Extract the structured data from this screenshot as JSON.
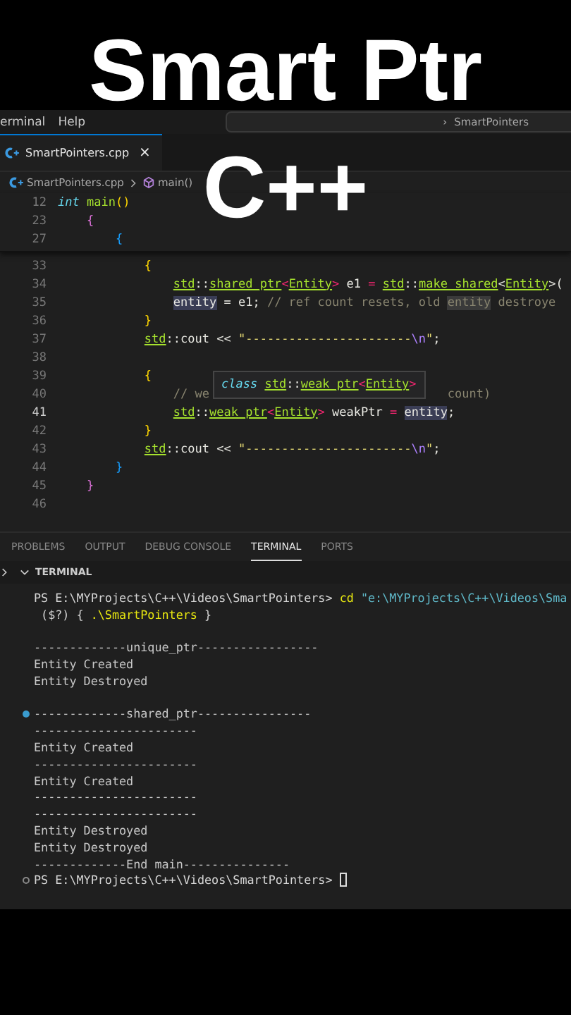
{
  "overlay_title": [
    "Smart Ptr",
    "C++"
  ],
  "menu": [
    "erminal",
    "Help"
  ],
  "command_center": {
    "separator": "›",
    "label": "SmartPointers"
  },
  "tabs": [
    {
      "label": "SmartPointers.cpp",
      "selected": true,
      "close": "×"
    }
  ],
  "breadcrumbs": [
    {
      "label": "SmartPointers.cpp",
      "kind": "file"
    },
    {
      "label": "main()",
      "kind": "symbol"
    }
  ],
  "sticky_lines": [
    {
      "n": "12",
      "tokens": [
        {
          "t": "int",
          "kind": "kw"
        },
        {
          "t": " main",
          "kind": "fn"
        },
        {
          "t": "()",
          "kind": "bg"
        }
      ]
    },
    {
      "n": "23",
      "tokens": [
        {
          "t": "    {",
          "kind": "bm"
        }
      ]
    },
    {
      "n": "27",
      "tokens": [
        {
          "t": "        {",
          "kind": "bb"
        }
      ]
    }
  ],
  "code_lines": [
    {
      "n": "33",
      "tokens": [
        {
          "t": "            {",
          "kind": "bg"
        }
      ]
    },
    {
      "n": "34",
      "tokens": [
        {
          "t": "                std",
          "kind": "ns"
        },
        {
          "t": "::",
          "kind": "plain"
        },
        {
          "t": "shared_ptr",
          "kind": "ns"
        },
        {
          "t": "<",
          "kind": "op"
        },
        {
          "t": "Entity",
          "kind": "ns"
        },
        {
          "t": ">",
          "kind": "op"
        },
        {
          "t": " e1 ",
          "kind": "plain"
        },
        {
          "t": "= ",
          "kind": "op"
        },
        {
          "t": "std",
          "kind": "ns"
        },
        {
          "t": "::",
          "kind": "plain"
        },
        {
          "t": "make_shared",
          "kind": "ns"
        },
        {
          "t": "<",
          "kind": "plain"
        },
        {
          "t": "Entity",
          "kind": "ns"
        },
        {
          "t": ">(",
          "kind": "plain"
        }
      ]
    },
    {
      "n": "35",
      "tokens": [
        {
          "t": "                entity",
          "kind": "hl"
        },
        {
          "t": " = e1; ",
          "kind": "plain"
        },
        {
          "t": "// ref count resets, old ",
          "kind": "com"
        },
        {
          "t": "entity",
          "kind": "comhl"
        },
        {
          "t": " destroye",
          "kind": "com"
        }
      ]
    },
    {
      "n": "36",
      "tokens": [
        {
          "t": "            }",
          "kind": "bg"
        }
      ]
    },
    {
      "n": "37",
      "tokens": [
        {
          "t": "            std",
          "kind": "ns"
        },
        {
          "t": "::cout << ",
          "kind": "plain"
        },
        {
          "t": "\"-----------------------",
          "kind": "str"
        },
        {
          "t": "\\n",
          "kind": "esc"
        },
        {
          "t": "\"",
          "kind": "str"
        },
        {
          "t": ";",
          "kind": "plain"
        }
      ]
    },
    {
      "n": "38"
    },
    {
      "n": "39",
      "tokens": [
        {
          "t": "            {",
          "kind": "bg"
        }
      ]
    },
    {
      "n": "40",
      "segments": [
        [
          {
            "t": "                // we",
            "kind": "com"
          }
        ],
        [
          {
            "t": "                                 count)",
            "kind": "com"
          }
        ]
      ]
    },
    {
      "n": "41",
      "tokens": [
        {
          "t": "                std",
          "kind": "ns"
        },
        {
          "t": "::",
          "kind": "plain"
        },
        {
          "t": "weak_ptr",
          "kind": "ns"
        },
        {
          "t": "<",
          "kind": "op"
        },
        {
          "t": "Entity",
          "kind": "ns"
        },
        {
          "t": ">",
          "kind": "op"
        },
        {
          "t": " weakPtr ",
          "kind": "plain"
        },
        {
          "t": "= ",
          "kind": "op"
        },
        {
          "t": "entity",
          "kind": "hl"
        },
        {
          "t": ";",
          "kind": "plain"
        }
      ]
    },
    {
      "n": "42",
      "tokens": [
        {
          "t": "            }",
          "kind": "bg"
        }
      ]
    },
    {
      "n": "43",
      "tokens": [
        {
          "t": "            std",
          "kind": "ns"
        },
        {
          "t": "::cout << ",
          "kind": "plain"
        },
        {
          "t": "\"-----------------------",
          "kind": "str"
        },
        {
          "t": "\\n",
          "kind": "esc"
        },
        {
          "t": "\"",
          "kind": "str"
        },
        {
          "t": ";",
          "kind": "plain"
        }
      ]
    },
    {
      "n": "44",
      "tokens": [
        {
          "t": "        }",
          "kind": "bb"
        }
      ]
    },
    {
      "n": "45",
      "tokens": [
        {
          "t": "    }",
          "kind": "bm"
        }
      ]
    },
    {
      "n": "46"
    }
  ],
  "hover": {
    "tokens": [
      {
        "t": "class",
        "kind": "kw"
      },
      {
        "t": " std",
        "kind": "ns"
      },
      {
        "t": "::",
        "kind": "plain"
      },
      {
        "t": "weak_ptr",
        "kind": "ns"
      },
      {
        "t": "<",
        "kind": "op"
      },
      {
        "t": "Entity",
        "kind": "ns"
      },
      {
        "t": ">",
        "kind": "op"
      }
    ]
  },
  "panel_tabs": [
    {
      "label": "PROBLEMS",
      "selected": false
    },
    {
      "label": "OUTPUT",
      "selected": false
    },
    {
      "label": "DEBUG CONSOLE",
      "selected": false
    },
    {
      "label": "TERMINAL",
      "selected": true
    },
    {
      "label": "PORTS",
      "selected": false
    }
  ],
  "terminal": {
    "title": "TERMINAL",
    "lines": [
      {
        "kind": "text",
        "segs": [
          {
            "t": "PS E:\\MYProjects\\C++\\Videos\\SmartPointers> ",
            "kind": "plain"
          },
          {
            "t": "cd",
            "kind": "cmd"
          },
          {
            "t": " \"e:\\MYProjects\\C++\\Videos\\Sma",
            "kind": "arg"
          }
        ]
      },
      {
        "kind": "text",
        "segs": [
          {
            "t": " ($?) { ",
            "kind": "plain"
          },
          {
            "t": ".\\SmartPointers",
            "kind": "cmd"
          },
          {
            "t": " }",
            "kind": "plain"
          }
        ]
      },
      {
        "kind": "blank"
      },
      {
        "kind": "text",
        "segs": [
          {
            "t": "-------------unique_ptr-----------------",
            "kind": "out"
          }
        ]
      },
      {
        "kind": "text",
        "segs": [
          {
            "t": "Entity Created",
            "kind": "out"
          }
        ]
      },
      {
        "kind": "text",
        "segs": [
          {
            "t": "Entity Destroyed",
            "kind": "out"
          }
        ]
      },
      {
        "kind": "blank"
      },
      {
        "kind": "text",
        "marker": true,
        "done": true,
        "segs": [
          {
            "t": "-------------shared_ptr----------------",
            "kind": "out"
          }
        ]
      },
      {
        "kind": "text",
        "segs": [
          {
            "t": "-----------------------",
            "kind": "out"
          }
        ]
      },
      {
        "kind": "text",
        "segs": [
          {
            "t": "Entity Created",
            "kind": "out"
          }
        ]
      },
      {
        "kind": "text",
        "segs": [
          {
            "t": "-----------------------",
            "kind": "out"
          }
        ]
      },
      {
        "kind": "text",
        "segs": [
          {
            "t": "Entity Created",
            "kind": "out"
          }
        ]
      },
      {
        "kind": "text",
        "segs": [
          {
            "t": "-----------------------",
            "kind": "out"
          }
        ]
      },
      {
        "kind": "text",
        "segs": [
          {
            "t": "-----------------------",
            "kind": "out"
          }
        ]
      },
      {
        "kind": "text",
        "segs": [
          {
            "t": "Entity Destroyed",
            "kind": "out"
          }
        ]
      },
      {
        "kind": "text",
        "segs": [
          {
            "t": "Entity Destroyed",
            "kind": "out"
          }
        ]
      },
      {
        "kind": "text",
        "segs": [
          {
            "t": "-------------End main---------------",
            "kind": "out"
          }
        ]
      },
      {
        "kind": "text",
        "marker": true,
        "done": false,
        "cursor": true,
        "segs": [
          {
            "t": "PS E:\\MYProjects\\C++\\Videos\\SmartPointers> ",
            "kind": "plain"
          }
        ]
      }
    ]
  }
}
